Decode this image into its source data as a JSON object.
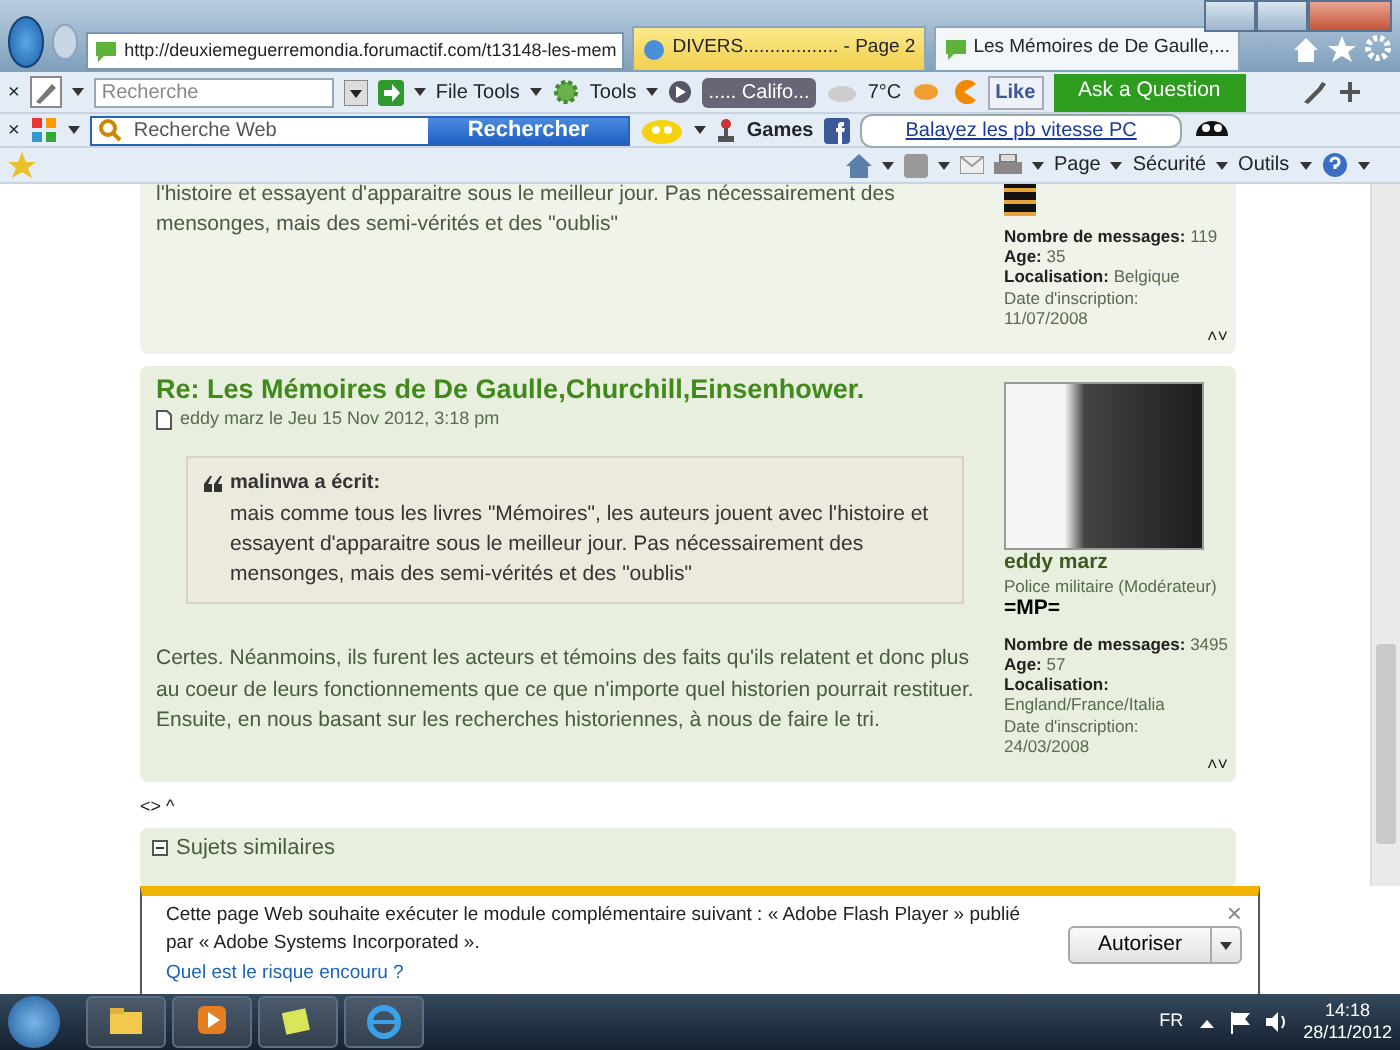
{
  "browser": {
    "address": "http://deuxiemeguerremondia.forumactif.com/t13148-les-mem",
    "tabs": [
      {
        "label": "DIVERS.................. - Page 2",
        "selected": false
      },
      {
        "label": "Les Mémoires de De Gaulle,...",
        "selected": true
      }
    ]
  },
  "toolbar_1": {
    "close": "×",
    "search_placeholder": "Recherche",
    "file_tools": "File Tools",
    "tools": "Tools",
    "radio": "..... Califo...",
    "weather": "7°C",
    "like": "Like",
    "ask": "Ask a Question"
  },
  "toolbar_2": {
    "close": "×",
    "search_placeholder": "Recherche Web",
    "search_button": "Rechercher",
    "games": "Games",
    "ad": "Balayez les pb vitesse PC"
  },
  "command_bar": [
    "Page",
    "Sécurité",
    "Outils"
  ],
  "posts": [
    {
      "body": "l'histoire et essayent d'apparaitre sous le meilleur jour. Pas nécessairement des mensonges, mais des semi-vérités et des \"oublis\"",
      "stats": [
        {
          "label": "Nombre de messages:",
          "value": "119",
          "bold": true
        },
        {
          "label": "Age:",
          "value": "35",
          "bold": true
        },
        {
          "label": "Localisation:",
          "value": "Belgique",
          "bold": true
        },
        {
          "label": "Date d'inscription:",
          "value": "11/07/2008",
          "bold": false
        }
      ],
      "nav": "˄˅"
    },
    {
      "title": "Re: Les Mémoires de De Gaulle,Churchill,Einsenhower.",
      "meta": "eddy marz le Jeu 15 Nov 2012, 3:18 pm",
      "quote": {
        "author": "malinwa a écrit:",
        "text": "mais comme tous les livres \"Mémoires\", les auteurs jouent avec l'histoire et essayent d'apparaitre sous le meilleur jour. Pas nécessairement des mensonges, mais des semi-vérités et des \"oublis\""
      },
      "body": "Certes. Néanmoins, ils furent les acteurs et témoins des faits qu'ils relatent et donc plus au coeur de leurs fonctionnements que ce que n'importe quel historien pourrait restituer. Ensuite, en nous basant sur les recherches historiennes, à nous de faire le tri.",
      "author": "eddy marz",
      "rank": "Police militaire (Modérateur)",
      "badge": "=MP=",
      "stats": [
        {
          "label": "Nombre de messages:",
          "value": "3495",
          "bold": true
        },
        {
          "label": "Age:",
          "value": "57",
          "bold": true
        },
        {
          "label": "Localisation:",
          "value": "England/France/Italia",
          "bold": true
        },
        {
          "label": "Date d'inscription:",
          "value": "24/03/2008",
          "bold": false
        }
      ],
      "nav": "˄˅"
    }
  ],
  "page_nav": "<> ^",
  "similar": {
    "title": "Sujets similaires"
  },
  "notification": {
    "text": "Cette page Web souhaite exécuter le module complémentaire suivant : « Adobe Flash Player » publié par « Adobe Systems Incorporated ».",
    "link": "Quel est le risque encouru ?",
    "button": "Autoriser",
    "close": "×"
  },
  "taskbar": {
    "language": "FR",
    "time": "14:18",
    "date": "28/11/2012"
  }
}
